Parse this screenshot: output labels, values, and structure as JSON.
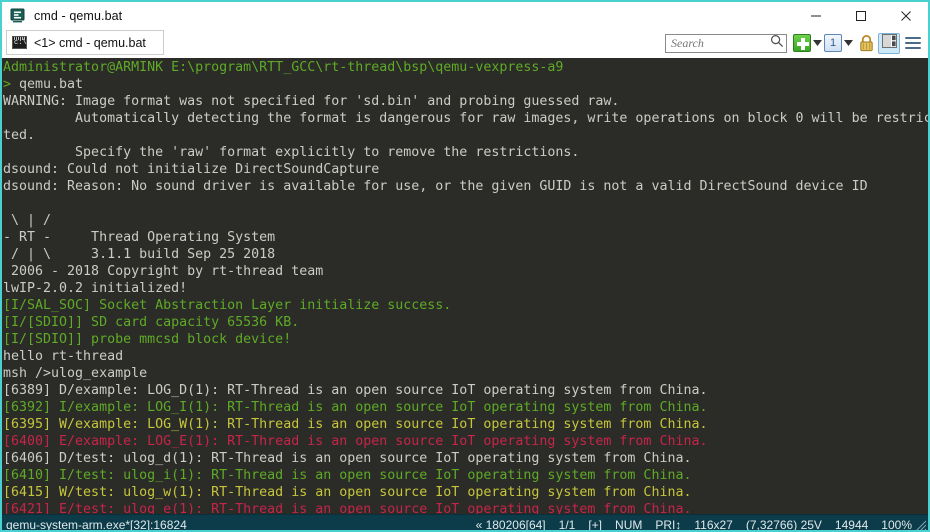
{
  "window": {
    "title": "cmd - qemu.bat",
    "icon": "console-app-icon",
    "border_color": "#49d0d0",
    "buttons": [
      {
        "name": "minimize-button",
        "glyph": "minimize-icon"
      },
      {
        "name": "maximize-button",
        "glyph": "maximize-icon"
      },
      {
        "name": "close-button",
        "glyph": "close-icon"
      }
    ]
  },
  "tab": {
    "label": "<1> cmd - qemu.bat",
    "icon": "cmd-console-icon"
  },
  "toolbar": {
    "search": {
      "placeholder": "Search",
      "value": "",
      "icon": "search-icon"
    },
    "new_console": {
      "icon": "green-plus-icon",
      "label": "+"
    },
    "new_console_dropdown": {
      "icon": "chevron-down-icon"
    },
    "active_console": {
      "icon": "console-number-icon",
      "label": "1"
    },
    "active_console_dropdown": {
      "icon": "chevron-down-icon"
    },
    "lock": {
      "icon": "lock-icon"
    },
    "panel": {
      "icon": "split-panel-icon"
    },
    "menu": {
      "icon": "hamburger-menu-icon"
    }
  },
  "terminal": {
    "background": "#2b2b28",
    "colors": {
      "white": "#ccccc6",
      "green": "#5faa26",
      "yellow": "#c6c63c",
      "red": "#c62548"
    },
    "lines": [
      [
        {
          "t": "Administrator@ARMINK E:\\program\\RTT_GCC\\rt-thread\\bsp\\qemu-vexpress-a9",
          "c": "green"
        }
      ],
      [
        {
          "t": "> ",
          "c": "green"
        },
        {
          "t": "qemu.bat",
          "c": "white"
        }
      ],
      [
        {
          "t": "WARNING: Image format was not specified for 'sd.bin' and probing guessed raw.",
          "c": "white"
        }
      ],
      [
        {
          "t": "         Automatically detecting the format is dangerous for raw images, write operations on block 0 will be restric",
          "c": "white"
        }
      ],
      [
        {
          "t": "ted.",
          "c": "white"
        }
      ],
      [
        {
          "t": "         Specify the 'raw' format explicitly to remove the restrictions.",
          "c": "white"
        }
      ],
      [
        {
          "t": "dsound: Could not initialize DirectSoundCapture",
          "c": "white"
        }
      ],
      [
        {
          "t": "dsound: Reason: No sound driver is available for use, or the given GUID is not a valid DirectSound device ID",
          "c": "white"
        }
      ],
      [
        {
          "t": "",
          "c": "white"
        }
      ],
      [
        {
          "t": " \\ | /",
          "c": "white"
        }
      ],
      [
        {
          "t": "- RT -     Thread Operating System",
          "c": "white"
        }
      ],
      [
        {
          "t": " / | \\     3.1.1 build Sep 25 2018",
          "c": "white"
        }
      ],
      [
        {
          "t": " 2006 - 2018 Copyright by rt-thread team",
          "c": "white"
        }
      ],
      [
        {
          "t": "lwIP-2.0.2 initialized!",
          "c": "white"
        }
      ],
      [
        {
          "t": "[I/SAL_SOC] Socket Abstraction Layer initialize success.",
          "c": "green"
        }
      ],
      [
        {
          "t": "[I/[SDIO]] SD card capacity 65536 KB.",
          "c": "green"
        }
      ],
      [
        {
          "t": "[I/[SDIO]] probe mmcsd block device!",
          "c": "green"
        }
      ],
      [
        {
          "t": "hello rt-thread",
          "c": "white"
        }
      ],
      [
        {
          "t": "msh />ulog_example",
          "c": "white"
        }
      ],
      [
        {
          "t": "[6389] D/example: LOG_D(1): RT-Thread is an open source IoT operating system from China.",
          "c": "white"
        }
      ],
      [
        {
          "t": "[6392] I/example: LOG_I(1): RT-Thread is an open source IoT operating system from China.",
          "c": "green"
        }
      ],
      [
        {
          "t": "[6395] W/example: LOG_W(1): RT-Thread is an open source IoT operating system from China.",
          "c": "yellow"
        }
      ],
      [
        {
          "t": "[6400] E/example: LOG_E(1): RT-Thread is an open source IoT operating system from China.",
          "c": "red"
        }
      ],
      [
        {
          "t": "[6406] D/test: ulog_d(1): RT-Thread is an open source IoT operating system from China.",
          "c": "white"
        }
      ],
      [
        {
          "t": "[6410] I/test: ulog_i(1): RT-Thread is an open source IoT operating system from China.",
          "c": "green"
        }
      ],
      [
        {
          "t": "[6415] W/test: ulog_w(1): RT-Thread is an open source IoT operating system from China.",
          "c": "yellow"
        }
      ],
      [
        {
          "t": "[6421] E/test: ulog_e(1): RT-Thread is an open source IoT operating system from China.",
          "c": "red"
        }
      ]
    ]
  },
  "statusbar": {
    "background": "#0c3b4a",
    "process": "qemu-system-arm.exe*[32]:16824",
    "items": [
      {
        "name": "status-build",
        "text": "« 180206[64]"
      },
      {
        "name": "status-console-count",
        "text": "1/1"
      },
      {
        "name": "status-mode",
        "text": "[+]"
      },
      {
        "name": "status-numlock",
        "text": "NUM"
      },
      {
        "name": "status-priority",
        "text": "PRI↕"
      },
      {
        "name": "status-size",
        "text": "116x27"
      },
      {
        "name": "status-cursor",
        "text": "(7,32766) 25V"
      },
      {
        "name": "status-memory",
        "text": "14944"
      },
      {
        "name": "status-zoom",
        "text": "100%"
      }
    ]
  }
}
